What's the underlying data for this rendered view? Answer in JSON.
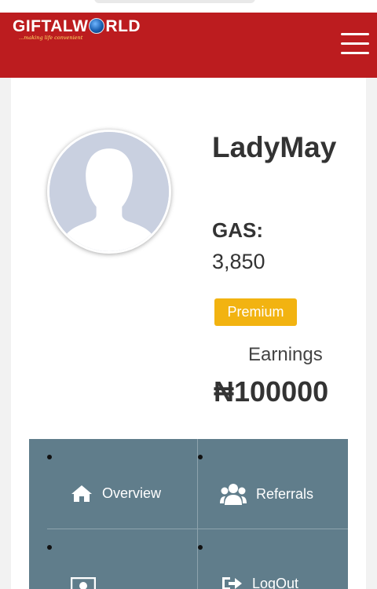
{
  "header": {
    "logo_text": "GIFTALW",
    "logo_text_end": "RLD",
    "logo_tagline": "...making life convenient",
    "menu_icon": "hamburger-menu-icon"
  },
  "profile": {
    "username": "LadyMay",
    "gas_label": "GAS:",
    "gas_value": "3,850",
    "badge": "Premium",
    "earnings_label": "Earnings",
    "earnings_value": "₦100000"
  },
  "nav": {
    "items": [
      {
        "label": "Overview",
        "icon": "home-icon"
      },
      {
        "label": "Referrals",
        "icon": "users-icon"
      },
      {
        "label": "",
        "icon": "money-icon"
      },
      {
        "label": "LogOut",
        "icon": "logout-icon"
      }
    ]
  },
  "colors": {
    "header": "#bc1c1f",
    "nav": "#607d8b",
    "badge": "#f2b311"
  }
}
